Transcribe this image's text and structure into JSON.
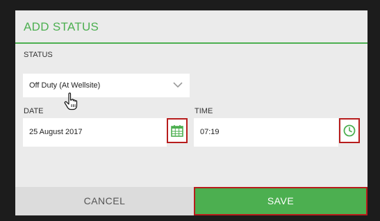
{
  "dialog": {
    "title": "ADD STATUS",
    "status": {
      "label": "STATUS",
      "selected": "Off Duty (At Wellsite)"
    },
    "date": {
      "label": "DATE",
      "value": "25 August 2017"
    },
    "time": {
      "label": "TIME",
      "value": "07:19"
    },
    "buttons": {
      "cancel": "CANCEL",
      "save": "SAVE"
    }
  },
  "colors": {
    "accent": "#4caf50",
    "highlight_border": "#b71c1c"
  },
  "icons": {
    "dropdown": "chevron-down-icon",
    "cursor": "hand-pointer-icon",
    "date_picker": "calendar-icon",
    "time_picker": "clock-icon"
  }
}
